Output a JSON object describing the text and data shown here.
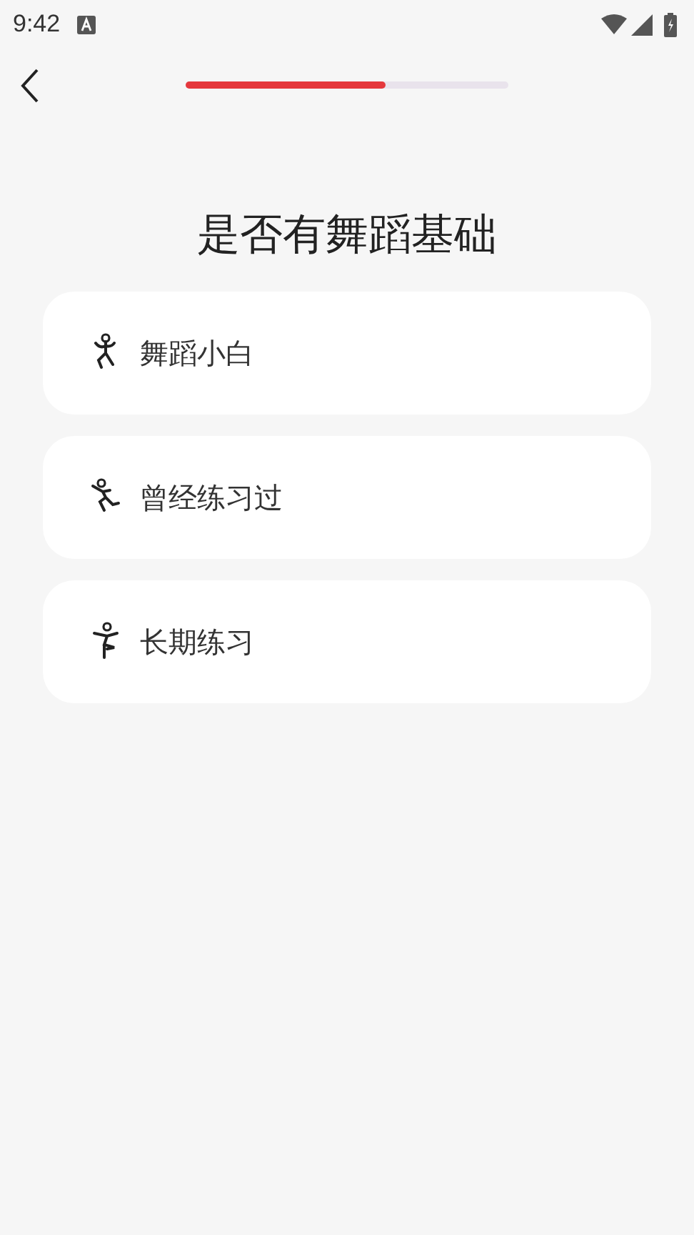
{
  "status_bar": {
    "time": "9:42"
  },
  "progress": {
    "level": 0.62
  },
  "question": "是否有舞蹈基础",
  "options": [
    {
      "label": "舞蹈小白"
    },
    {
      "label": "曾经练习过"
    },
    {
      "label": "长期练习"
    }
  ]
}
